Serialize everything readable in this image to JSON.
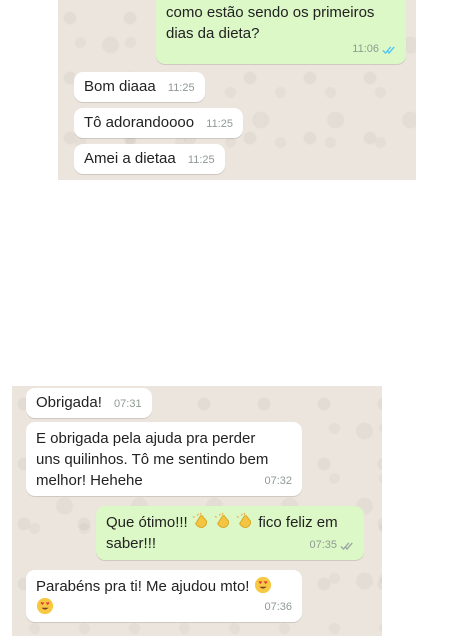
{
  "screenshot_top": {
    "messages": [
      {
        "direction": "outgoing",
        "text_line1": "como estão sendo os primeiros",
        "text_line2": "dias da dieta?",
        "time": "11:06",
        "status": "read"
      },
      {
        "direction": "incoming",
        "text": "Bom diaaa",
        "time": "11:25"
      },
      {
        "direction": "incoming",
        "text": "Tô adorandoooo",
        "time": "11:25"
      },
      {
        "direction": "incoming",
        "text": "Amei a dietaa",
        "time": "11:25"
      }
    ]
  },
  "screenshot_bottom": {
    "messages": [
      {
        "direction": "incoming",
        "text": "Obrigada!",
        "time": "07:31"
      },
      {
        "direction": "incoming",
        "text_line1": "E obrigada pela ajuda pra perder",
        "text_line2": "uns quilinhos. Tô me sentindo bem",
        "text_line3": "melhor! Hehehe",
        "time": "07:32"
      },
      {
        "direction": "outgoing",
        "text_part1": "Que ótimo!!!",
        "text_part2": "fico feliz em",
        "text_line2": "saber!!!",
        "time": "07:35",
        "status": "delivered",
        "emoji": "clapping-hands-icon"
      },
      {
        "direction": "incoming",
        "text_line1": "Parabéns pra ti! Me ajudou mto!",
        "time": "07:36",
        "emoji": "heart-eyes-icon"
      }
    ]
  },
  "colors": {
    "chat_background": "#ece5dd",
    "outgoing_bubble": "#dcf8c6",
    "incoming_bubble": "#ffffff",
    "read_ticks": "#4fc3f7",
    "delivered_ticks": "#9aa5a0"
  }
}
